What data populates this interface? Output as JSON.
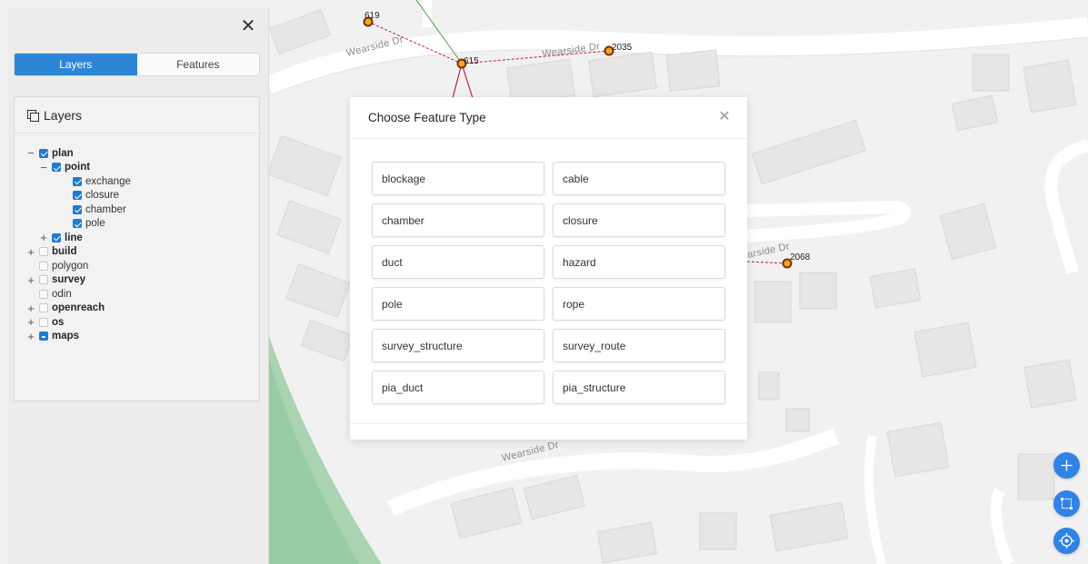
{
  "map": {
    "street_labels": [
      "Wearside Dr",
      "Wearside Dr",
      "Wearside Dr",
      "arside Dr"
    ],
    "node_labels": [
      "619",
      "615",
      "2035",
      "2068"
    ],
    "colors": {
      "background": "#f1f1f1",
      "building": "#e6e6e6",
      "road": "#ffffff",
      "green": "#8fc79c",
      "node": "#f5a623",
      "link": "#c2185b"
    }
  },
  "side_panel": {
    "close_icon": "close-icon",
    "tabs": [
      {
        "label": "Layers",
        "active": true
      },
      {
        "label": "Features",
        "active": false
      }
    ],
    "layers_card": {
      "title": "Layers",
      "icon": "layers-icon",
      "tree": [
        {
          "label": "plan",
          "level": 0,
          "toggle": "−",
          "state": "checked",
          "bold": true
        },
        {
          "label": "point",
          "level": 1,
          "toggle": "−",
          "state": "checked",
          "bold": true
        },
        {
          "label": "exchange",
          "level": 2,
          "toggle": "",
          "state": "checked",
          "bold": false
        },
        {
          "label": "closure",
          "level": 2,
          "toggle": "",
          "state": "checked",
          "bold": false
        },
        {
          "label": "chamber",
          "level": 2,
          "toggle": "",
          "state": "checked",
          "bold": false
        },
        {
          "label": "pole",
          "level": 2,
          "toggle": "",
          "state": "checked",
          "bold": false
        },
        {
          "label": "line",
          "level": 1,
          "toggle": "+",
          "state": "checked",
          "bold": true
        },
        {
          "label": "build",
          "level": 0,
          "toggle": "+",
          "state": "unchecked",
          "bold": true
        },
        {
          "label": "polygon",
          "level": 0,
          "toggle": "",
          "state": "unchecked",
          "bold": false
        },
        {
          "label": "survey",
          "level": 0,
          "toggle": "+",
          "state": "unchecked",
          "bold": true
        },
        {
          "label": "odin",
          "level": 0,
          "toggle": "",
          "state": "unchecked",
          "bold": false
        },
        {
          "label": "openreach",
          "level": 0,
          "toggle": "+",
          "state": "unchecked",
          "bold": true
        },
        {
          "label": "os",
          "level": 0,
          "toggle": "+",
          "state": "unchecked",
          "bold": true
        },
        {
          "label": "maps",
          "level": 0,
          "toggle": "+",
          "state": "partial",
          "bold": true
        }
      ]
    }
  },
  "modal": {
    "title": "Choose Feature Type",
    "close_icon": "close-icon",
    "feature_types": [
      "blockage",
      "cable",
      "chamber",
      "closure",
      "duct",
      "hazard",
      "pole",
      "rope",
      "survey_structure",
      "survey_route",
      "pia_duct",
      "pia_structure"
    ]
  },
  "fab_buttons": [
    {
      "name": "add-button",
      "icon": "plus-icon"
    },
    {
      "name": "select-area-button",
      "icon": "crop-icon"
    },
    {
      "name": "locate-button",
      "icon": "crosshair-icon"
    }
  ],
  "accent_color": "#1c7bd3"
}
